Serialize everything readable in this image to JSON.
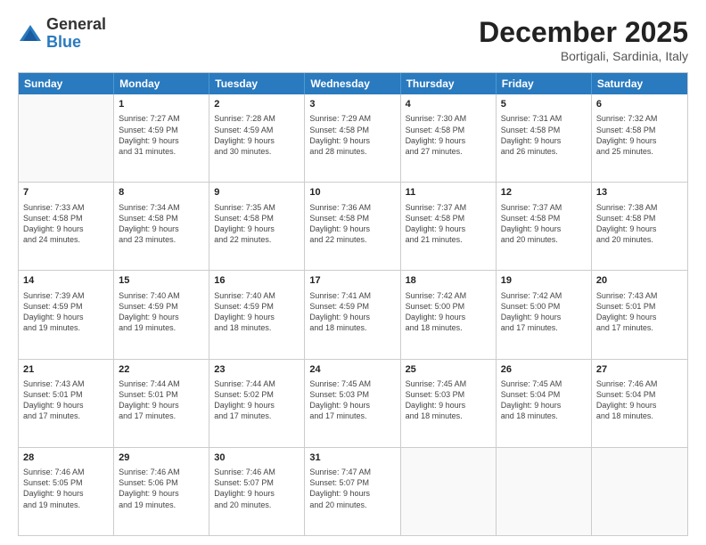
{
  "header": {
    "logo_general": "General",
    "logo_blue": "Blue",
    "month_title": "December 2025",
    "location": "Bortigali, Sardinia, Italy"
  },
  "days_of_week": [
    "Sunday",
    "Monday",
    "Tuesday",
    "Wednesday",
    "Thursday",
    "Friday",
    "Saturday"
  ],
  "weeks": [
    [
      {
        "day": "",
        "empty": true
      },
      {
        "day": "1",
        "sunrise": "Sunrise: 7:27 AM",
        "sunset": "Sunset: 4:59 PM",
        "daylight": "Daylight: 9 hours",
        "daylight2": "and 31 minutes."
      },
      {
        "day": "2",
        "sunrise": "Sunrise: 7:28 AM",
        "sunset": "Sunset: 4:59 AM",
        "daylight": "Daylight: 9 hours",
        "daylight2": "and 30 minutes."
      },
      {
        "day": "3",
        "sunrise": "Sunrise: 7:29 AM",
        "sunset": "Sunset: 4:58 PM",
        "daylight": "Daylight: 9 hours",
        "daylight2": "and 28 minutes."
      },
      {
        "day": "4",
        "sunrise": "Sunrise: 7:30 AM",
        "sunset": "Sunset: 4:58 PM",
        "daylight": "Daylight: 9 hours",
        "daylight2": "and 27 minutes."
      },
      {
        "day": "5",
        "sunrise": "Sunrise: 7:31 AM",
        "sunset": "Sunset: 4:58 PM",
        "daylight": "Daylight: 9 hours",
        "daylight2": "and 26 minutes."
      },
      {
        "day": "6",
        "sunrise": "Sunrise: 7:32 AM",
        "sunset": "Sunset: 4:58 PM",
        "daylight": "Daylight: 9 hours",
        "daylight2": "and 25 minutes."
      }
    ],
    [
      {
        "day": "7",
        "sunrise": "Sunrise: 7:33 AM",
        "sunset": "Sunset: 4:58 PM",
        "daylight": "Daylight: 9 hours",
        "daylight2": "and 24 minutes."
      },
      {
        "day": "8",
        "sunrise": "Sunrise: 7:34 AM",
        "sunset": "Sunset: 4:58 PM",
        "daylight": "Daylight: 9 hours",
        "daylight2": "and 23 minutes."
      },
      {
        "day": "9",
        "sunrise": "Sunrise: 7:35 AM",
        "sunset": "Sunset: 4:58 PM",
        "daylight": "Daylight: 9 hours",
        "daylight2": "and 22 minutes."
      },
      {
        "day": "10",
        "sunrise": "Sunrise: 7:36 AM",
        "sunset": "Sunset: 4:58 PM",
        "daylight": "Daylight: 9 hours",
        "daylight2": "and 22 minutes."
      },
      {
        "day": "11",
        "sunrise": "Sunrise: 7:37 AM",
        "sunset": "Sunset: 4:58 PM",
        "daylight": "Daylight: 9 hours",
        "daylight2": "and 21 minutes."
      },
      {
        "day": "12",
        "sunrise": "Sunrise: 7:37 AM",
        "sunset": "Sunset: 4:58 PM",
        "daylight": "Daylight: 9 hours",
        "daylight2": "and 20 minutes."
      },
      {
        "day": "13",
        "sunrise": "Sunrise: 7:38 AM",
        "sunset": "Sunset: 4:58 PM",
        "daylight": "Daylight: 9 hours",
        "daylight2": "and 20 minutes."
      }
    ],
    [
      {
        "day": "14",
        "sunrise": "Sunrise: 7:39 AM",
        "sunset": "Sunset: 4:59 PM",
        "daylight": "Daylight: 9 hours",
        "daylight2": "and 19 minutes."
      },
      {
        "day": "15",
        "sunrise": "Sunrise: 7:40 AM",
        "sunset": "Sunset: 4:59 PM",
        "daylight": "Daylight: 9 hours",
        "daylight2": "and 19 minutes."
      },
      {
        "day": "16",
        "sunrise": "Sunrise: 7:40 AM",
        "sunset": "Sunset: 4:59 PM",
        "daylight": "Daylight: 9 hours",
        "daylight2": "and 18 minutes."
      },
      {
        "day": "17",
        "sunrise": "Sunrise: 7:41 AM",
        "sunset": "Sunset: 4:59 PM",
        "daylight": "Daylight: 9 hours",
        "daylight2": "and 18 minutes."
      },
      {
        "day": "18",
        "sunrise": "Sunrise: 7:42 AM",
        "sunset": "Sunset: 5:00 PM",
        "daylight": "Daylight: 9 hours",
        "daylight2": "and 18 minutes."
      },
      {
        "day": "19",
        "sunrise": "Sunrise: 7:42 AM",
        "sunset": "Sunset: 5:00 PM",
        "daylight": "Daylight: 9 hours",
        "daylight2": "and 17 minutes."
      },
      {
        "day": "20",
        "sunrise": "Sunrise: 7:43 AM",
        "sunset": "Sunset: 5:01 PM",
        "daylight": "Daylight: 9 hours",
        "daylight2": "and 17 minutes."
      }
    ],
    [
      {
        "day": "21",
        "sunrise": "Sunrise: 7:43 AM",
        "sunset": "Sunset: 5:01 PM",
        "daylight": "Daylight: 9 hours",
        "daylight2": "and 17 minutes."
      },
      {
        "day": "22",
        "sunrise": "Sunrise: 7:44 AM",
        "sunset": "Sunset: 5:01 PM",
        "daylight": "Daylight: 9 hours",
        "daylight2": "and 17 minutes."
      },
      {
        "day": "23",
        "sunrise": "Sunrise: 7:44 AM",
        "sunset": "Sunset: 5:02 PM",
        "daylight": "Daylight: 9 hours",
        "daylight2": "and 17 minutes."
      },
      {
        "day": "24",
        "sunrise": "Sunrise: 7:45 AM",
        "sunset": "Sunset: 5:03 PM",
        "daylight": "Daylight: 9 hours",
        "daylight2": "and 17 minutes."
      },
      {
        "day": "25",
        "sunrise": "Sunrise: 7:45 AM",
        "sunset": "Sunset: 5:03 PM",
        "daylight": "Daylight: 9 hours",
        "daylight2": "and 18 minutes."
      },
      {
        "day": "26",
        "sunrise": "Sunrise: 7:45 AM",
        "sunset": "Sunset: 5:04 PM",
        "daylight": "Daylight: 9 hours",
        "daylight2": "and 18 minutes."
      },
      {
        "day": "27",
        "sunrise": "Sunrise: 7:46 AM",
        "sunset": "Sunset: 5:04 PM",
        "daylight": "Daylight: 9 hours",
        "daylight2": "and 18 minutes."
      }
    ],
    [
      {
        "day": "28",
        "sunrise": "Sunrise: 7:46 AM",
        "sunset": "Sunset: 5:05 PM",
        "daylight": "Daylight: 9 hours",
        "daylight2": "and 19 minutes."
      },
      {
        "day": "29",
        "sunrise": "Sunrise: 7:46 AM",
        "sunset": "Sunset: 5:06 PM",
        "daylight": "Daylight: 9 hours",
        "daylight2": "and 19 minutes."
      },
      {
        "day": "30",
        "sunrise": "Sunrise: 7:46 AM",
        "sunset": "Sunset: 5:07 PM",
        "daylight": "Daylight: 9 hours",
        "daylight2": "and 20 minutes."
      },
      {
        "day": "31",
        "sunrise": "Sunrise: 7:47 AM",
        "sunset": "Sunset: 5:07 PM",
        "daylight": "Daylight: 9 hours",
        "daylight2": "and 20 minutes."
      },
      {
        "day": "",
        "empty": true
      },
      {
        "day": "",
        "empty": true
      },
      {
        "day": "",
        "empty": true
      }
    ]
  ]
}
